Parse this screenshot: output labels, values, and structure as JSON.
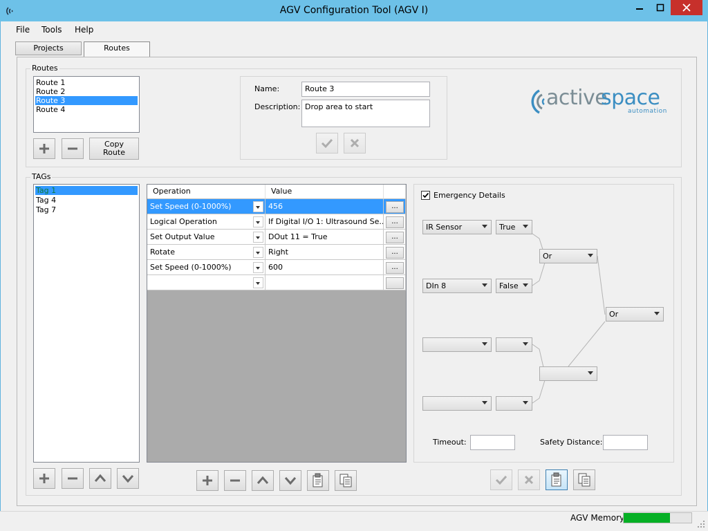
{
  "window": {
    "title": "AGV Configuration Tool (AGV I)"
  },
  "menu": {
    "items": [
      "File",
      "Tools",
      "Help"
    ]
  },
  "tabs": [
    {
      "label": "Projects",
      "selected": false
    },
    {
      "label": "Routes",
      "selected": true
    }
  ],
  "routes": {
    "group_label": "Routes",
    "items": [
      "Route 1",
      "Route 2",
      "Route 3",
      "Route 4"
    ],
    "selected_index": 2,
    "copy_button": "Copy\nRoute",
    "name_label": "Name:",
    "name_value": "Route 3",
    "description_label": "Description:",
    "description_value": "Drop area to start"
  },
  "logo": {
    "brand_part1": "active",
    "brand_part2": "space",
    "tagline": "automation",
    "color_gray": "#7b8d95",
    "color_blue": "#3b8ec2"
  },
  "tags": {
    "group_label": "TAGs",
    "items": [
      "Tag 1",
      "Tag 4",
      "Tag 7"
    ],
    "selected_index": 0
  },
  "grid": {
    "columns": [
      "Operation",
      "Value"
    ],
    "rows": [
      {
        "operation": "Set Speed (0-1000%)",
        "value": "456"
      },
      {
        "operation": "Logical Operation",
        "value": "If Digital I/O 1: Ultrasound Se..."
      },
      {
        "operation": "Set Output Value",
        "value": "DOut 11 = True"
      },
      {
        "operation": "Rotate",
        "value": "Right"
      },
      {
        "operation": "Set Speed (0-1000%)",
        "value": "600"
      },
      {
        "operation": "",
        "value": ""
      }
    ],
    "selected_row": 0,
    "ellipsis": "..."
  },
  "emergency": {
    "checkbox_label": "Emergency Details",
    "checked": true,
    "combos": {
      "sensor1": "IR Sensor",
      "state1": "True",
      "sensor2": "DIn 8",
      "state2": "False",
      "logic1": "Or",
      "logic_final": "Or",
      "sensor3": "",
      "state3": "",
      "sensor4": "",
      "state4": "",
      "logic2": ""
    },
    "timeout_label": "Timeout:",
    "timeout_value": "",
    "safety_label": "Safety Distance:",
    "safety_value": ""
  },
  "status": {
    "memory_label": "AGV Memory",
    "memory_fraction": 0.68,
    "bar_color": "#06b025"
  }
}
